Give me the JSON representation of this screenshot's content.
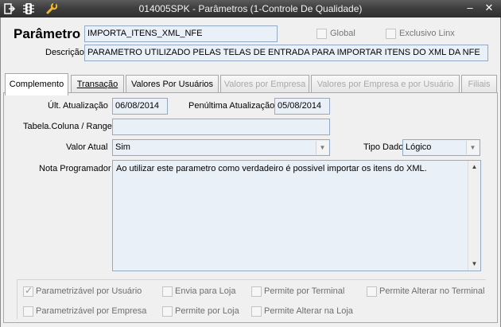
{
  "window": {
    "title": "014005SPK - Parâmetros (1-Controle De Qualidade)",
    "minimize_glyph": "–",
    "close_glyph": "✕",
    "icons": [
      "exit-icon",
      "traffic-light-icon",
      "wrench-icon"
    ]
  },
  "header": {
    "parametro_label": "Parâmetro",
    "parametro_value": "IMPORTA_ITENS_XML_NFE",
    "global_label": "Global",
    "global_checked": false,
    "exclusivo_label": "Exclusivo Linx",
    "exclusivo_checked": false,
    "descricao_label": "Descrição",
    "descricao_value": "PARAMETRO UTILIZADO PELAS TELAS DE ENTRADA PARA IMPORTAR ITENS DO XML DA NFE"
  },
  "tabs": [
    {
      "label": "Complemento",
      "active": true,
      "enabled": true
    },
    {
      "label": "Transação",
      "active": false,
      "enabled": true
    },
    {
      "label": "Valores Por Usuários",
      "active": false,
      "enabled": true
    },
    {
      "label": "Valores por Empresa",
      "active": false,
      "enabled": false
    },
    {
      "label": "Valores por Empresa e por Usuário",
      "active": false,
      "enabled": false
    },
    {
      "label": "Filiais",
      "active": false,
      "enabled": false
    }
  ],
  "complemento": {
    "ult_atualizacao_label": "Últ. Atualização",
    "ult_atualizacao_value": "06/08/2014",
    "penultima_label": "Penúltima Atualização",
    "penultima_value": "05/08/2014",
    "tabela_label": "Tabela.Coluna / Range",
    "tabela_value": "",
    "valor_atual_label": "Valor Atual",
    "valor_atual_value": "Sim",
    "tipo_dado_label": "Tipo Dado",
    "tipo_dado_value": "Lógico",
    "nota_label": "Nota Programador",
    "nota_value": "Ao utilizar este parametro como verdadeiro é possivel importar os itens do XML."
  },
  "checkboxes": [
    {
      "label": "Parametrizável por Usuário",
      "checked": true
    },
    {
      "label": "Envia para Loja",
      "checked": false
    },
    {
      "label": "Permite por Terminal",
      "checked": false
    },
    {
      "label": "Permite Alterar no Terminal",
      "checked": false
    },
    {
      "label": "Parametrizável por Empresa",
      "checked": false
    },
    {
      "label": "Permite por Loja",
      "checked": false
    },
    {
      "label": "Permite Alterar na Loja",
      "checked": false
    }
  ]
}
